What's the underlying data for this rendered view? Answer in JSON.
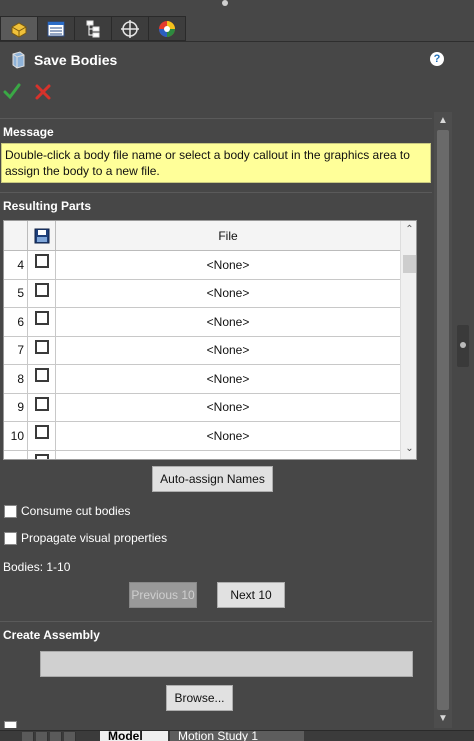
{
  "window": {
    "title": "Save Bodies",
    "help_label": "?"
  },
  "sections": {
    "message": {
      "header": "Message",
      "text": "Double-click a body file name or select a body callout in the graphics area to assign the body to a new file."
    },
    "resulting_parts": {
      "header": "Resulting Parts",
      "columns": {
        "file": "File"
      },
      "rows": [
        {
          "num": "4",
          "file": "<None>",
          "checked": false
        },
        {
          "num": "5",
          "file": "<None>",
          "checked": false
        },
        {
          "num": "6",
          "file": "<None>",
          "checked": false
        },
        {
          "num": "7",
          "file": "<None>",
          "checked": false
        },
        {
          "num": "8",
          "file": "<None>",
          "checked": false
        },
        {
          "num": "9",
          "file": "<None>",
          "checked": false
        },
        {
          "num": "10",
          "file": "<None>",
          "checked": false
        }
      ],
      "auto_assign_label": "Auto-assign Names",
      "consume_label": "Consume cut bodies",
      "propagate_label": "Propagate visual properties",
      "bodies_range": "Bodies: 1-10",
      "previous_label": "Previous 10",
      "next_label": "Next 10"
    },
    "create_assembly": {
      "header": "Create Assembly",
      "path_value": "",
      "browse_label": "Browse..."
    }
  },
  "bottom_tabs": [
    {
      "label": "Model",
      "active": true
    },
    {
      "label": "Motion Study 1",
      "active": false
    }
  ],
  "colors": {
    "panel_bg": "#474747",
    "message_bg": "#ffff99",
    "ok": "#3aa845",
    "cancel": "#d8322b"
  }
}
